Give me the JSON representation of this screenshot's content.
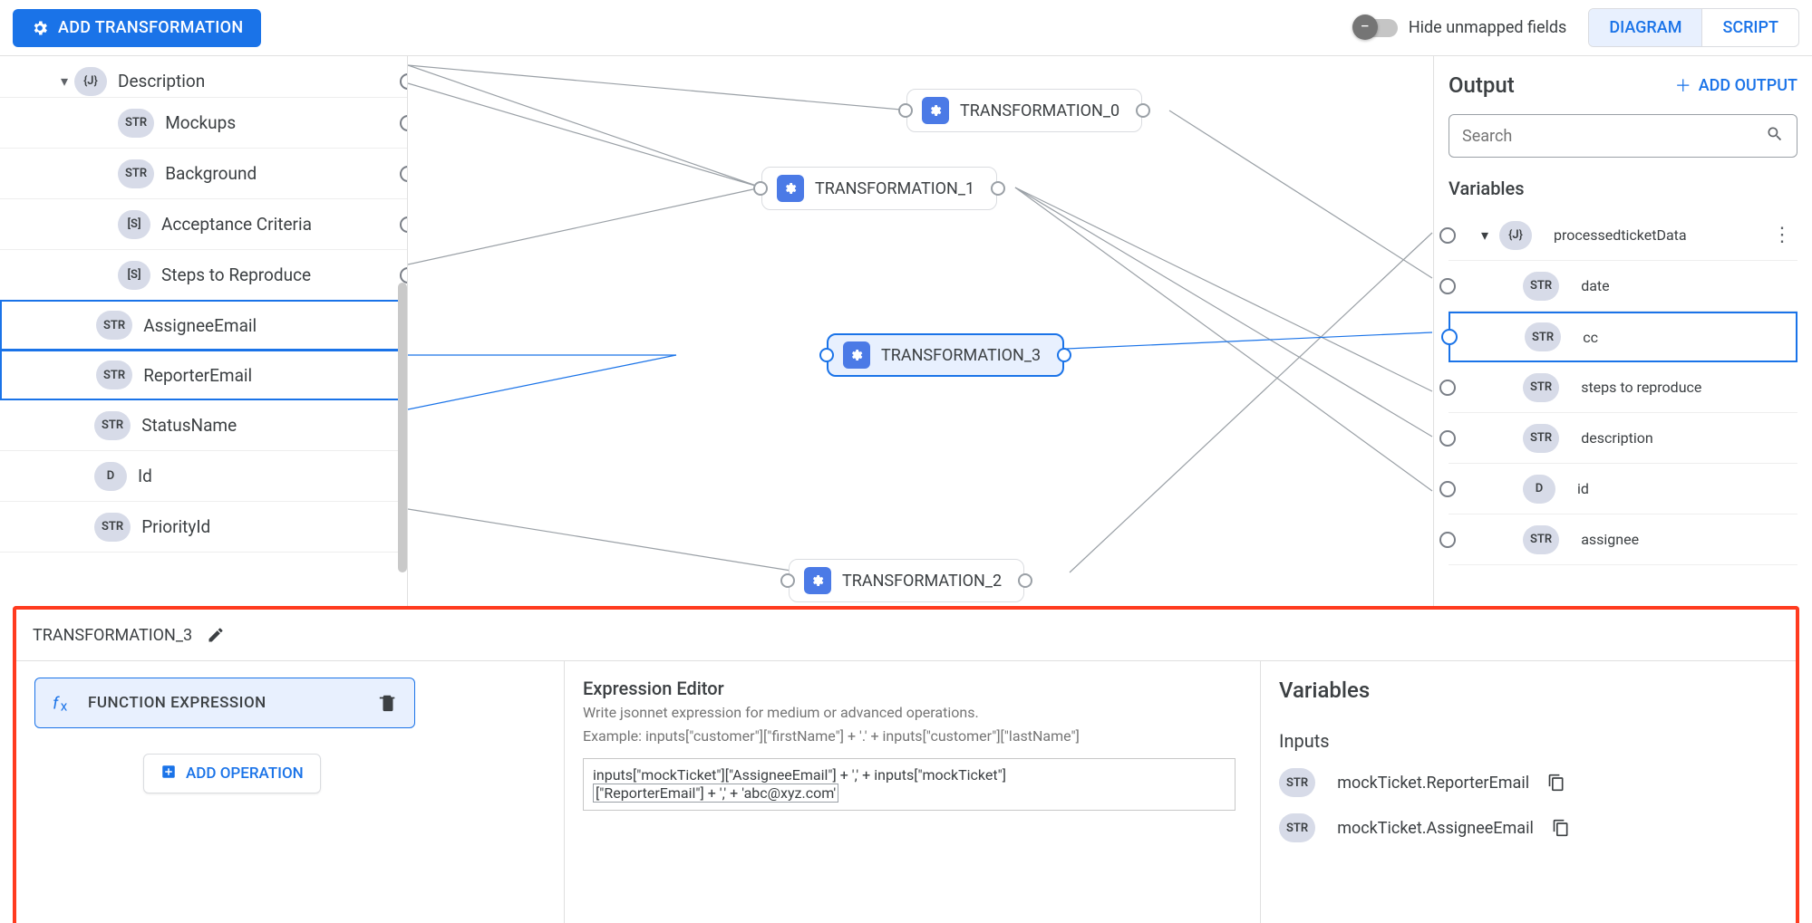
{
  "toolbar": {
    "addTransformation": "ADD TRANSFORMATION",
    "hideUnmapped": "Hide unmapped fields",
    "tabs": {
      "diagram": "DIAGRAM",
      "script": "SCRIPT"
    }
  },
  "inputTree": {
    "rootCaret": "▾",
    "items": [
      {
        "kind": "{J}",
        "label": "Description",
        "caret": true,
        "indent": 1,
        "selected": false
      },
      {
        "kind": "STR",
        "label": "Mockups",
        "indent": 2
      },
      {
        "kind": "STR",
        "label": "Background",
        "indent": 2
      },
      {
        "kind": "[S]",
        "label": "Acceptance Criteria",
        "indent": 2
      },
      {
        "kind": "[S]",
        "label": "Steps to Reproduce",
        "indent": 2
      },
      {
        "kind": "STR",
        "label": "AssigneeEmail",
        "indent": 1,
        "selected": true
      },
      {
        "kind": "STR",
        "label": "ReporterEmail",
        "indent": 1,
        "selected": true
      },
      {
        "kind": "STR",
        "label": "StatusName",
        "indent": 1
      },
      {
        "kind": "D",
        "label": "Id",
        "indent": 1
      },
      {
        "kind": "STR",
        "label": "PriorityId",
        "indent": 1
      }
    ]
  },
  "nodes": {
    "t0": "TRANSFORMATION_0",
    "t1": "TRANSFORMATION_1",
    "t2": "TRANSFORMATION_2",
    "t3": "TRANSFORMATION_3"
  },
  "output": {
    "title": "Output",
    "addOutput": "ADD OUTPUT",
    "searchPlaceholder": "Search",
    "variablesLabel": "Variables",
    "root": {
      "kind": "{J}",
      "label": "processedticketData"
    },
    "items": [
      {
        "kind": "STR",
        "label": "date"
      },
      {
        "kind": "STR",
        "label": "cc",
        "selected": true
      },
      {
        "kind": "STR",
        "label": "steps to reproduce"
      },
      {
        "kind": "STR",
        "label": "description"
      },
      {
        "kind": "D",
        "label": "id"
      },
      {
        "kind": "STR",
        "label": "assignee"
      }
    ]
  },
  "bottom": {
    "title": "TRANSFORMATION_3",
    "functionChip": "FUNCTION EXPRESSION",
    "addOperation": "ADD OPERATION",
    "expr": {
      "heading": "Expression Editor",
      "sub1": "Write jsonnet expression for medium or advanced operations.",
      "sub2": "Example: inputs[\"customer\"][\"firstName\"] + '.' + inputs[\"customer\"][\"lastName\"]",
      "codeLine1": "inputs[\"mockTicket\"][\"AssigneeEmail\"] + ',' + inputs[\"mockTicket\"]",
      "codeLine2": "[\"ReporterEmail\"] + ',' + 'abc@xyz.com'"
    },
    "vars": {
      "heading": "Variables",
      "inputsLabel": "Inputs",
      "rows": [
        {
          "kind": "STR",
          "label": "mockTicket.ReporterEmail"
        },
        {
          "kind": "STR",
          "label": "mockTicket.AssigneeEmail"
        }
      ]
    }
  }
}
